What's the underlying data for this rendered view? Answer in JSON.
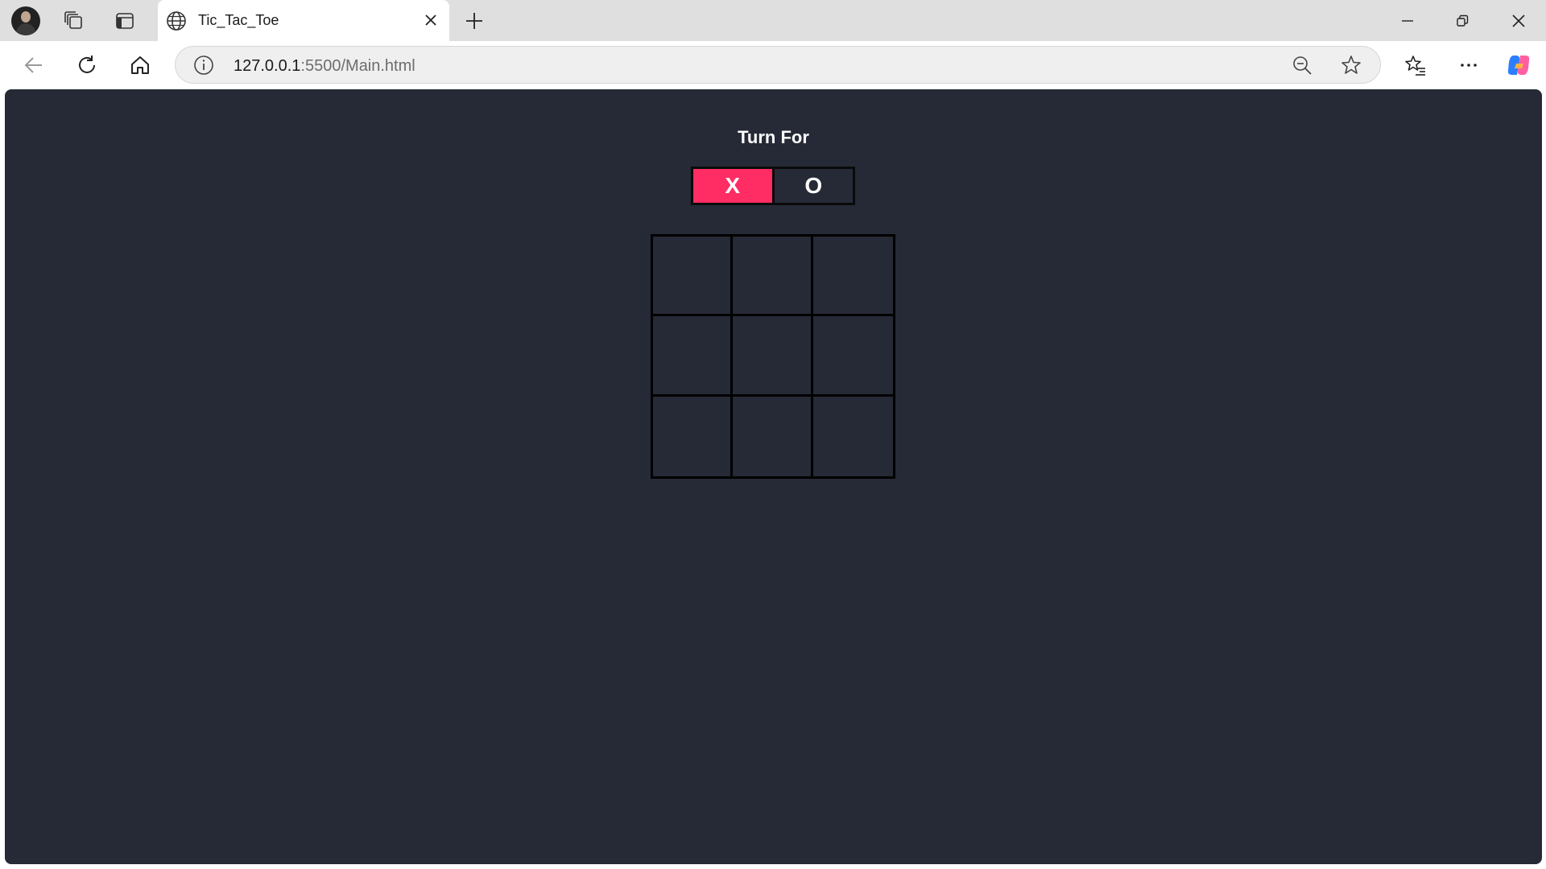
{
  "browser": {
    "tab_title": "Tic_Tac_Toe",
    "url_host": "127.0.0.1",
    "url_rest": ":5500/Main.html"
  },
  "game": {
    "turn_label": "Turn For",
    "players": [
      "X",
      "O"
    ],
    "active_player": "X",
    "active_color": "#ff2d63",
    "page_background": "#252a36",
    "board": [
      "",
      "",
      "",
      "",
      "",
      "",
      "",
      "",
      ""
    ]
  }
}
